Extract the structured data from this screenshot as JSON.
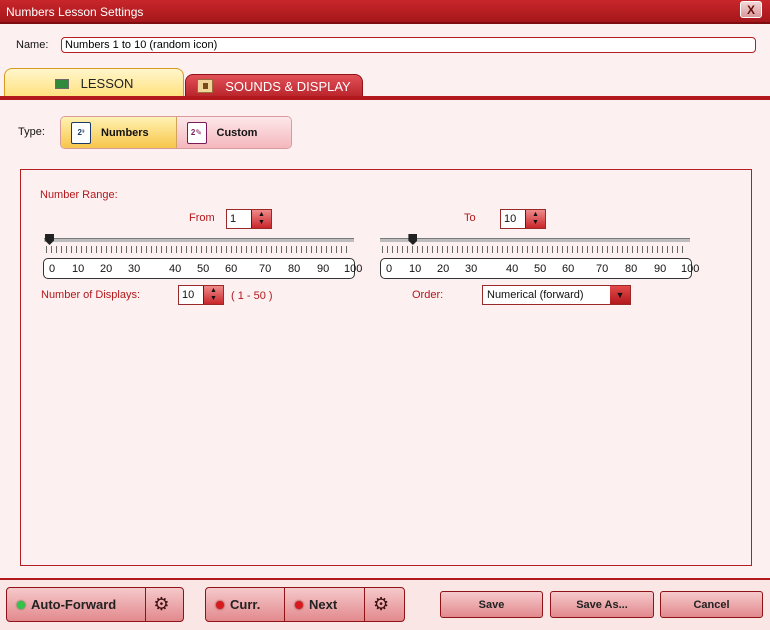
{
  "window": {
    "title": "Numbers Lesson Settings",
    "close_glyph": "X"
  },
  "name": {
    "label": "Name:",
    "value": "Numbers 1 to 10 (random icon)"
  },
  "tabs": [
    {
      "label": "LESSON",
      "icon": "lesson-icon",
      "selected": true
    },
    {
      "label": "SOUNDS & DISPLAY",
      "icon": "speaker-icon",
      "selected": false
    }
  ],
  "type": {
    "label": "Type:",
    "options": [
      {
        "label": "Numbers",
        "icon_text": "2 3\n1",
        "selected": true
      },
      {
        "label": "Custom",
        "icon_text": "2\n1",
        "selected": false
      }
    ]
  },
  "range": {
    "label": "Number Range:",
    "from": {
      "label": "From",
      "value": "1"
    },
    "to": {
      "label": "To",
      "value": "10"
    },
    "scale": [
      "0",
      "10",
      "20",
      "30",
      "40",
      "50",
      "60",
      "70",
      "80",
      "90",
      "100"
    ],
    "from_level": 1,
    "to_level": 10
  },
  "displays": {
    "label": "Number of Displays:",
    "value": "10",
    "hint": "( 1 - 50 )"
  },
  "order": {
    "label": "Order:",
    "value": "Numerical (forward)"
  },
  "footer": {
    "auto_forward": "Auto-Forward",
    "curr": "Curr.",
    "next": "Next",
    "save": "Save",
    "save_as": "Save As...",
    "cancel": "Cancel",
    "gear_glyph": "⚙"
  },
  "colors": {
    "accent": "#b3181c",
    "tab_selected": "#ffe07a",
    "panel_bg": "#fdf0f0"
  }
}
